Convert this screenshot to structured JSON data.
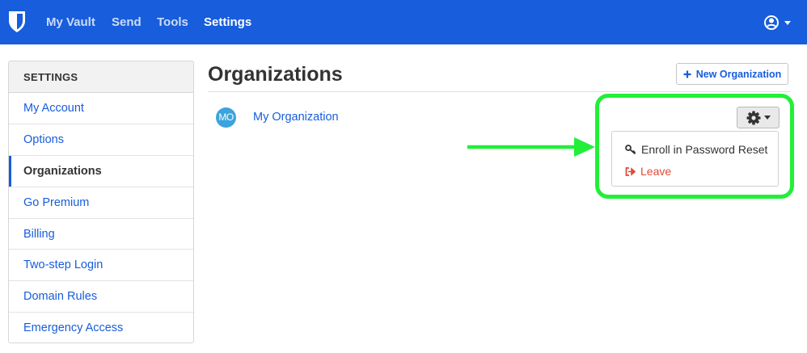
{
  "nav": {
    "items": [
      {
        "label": "My Vault",
        "active": false
      },
      {
        "label": "Send",
        "active": false
      },
      {
        "label": "Tools",
        "active": false
      },
      {
        "label": "Settings",
        "active": true
      }
    ]
  },
  "sidebar": {
    "header": "SETTINGS",
    "items": [
      {
        "label": "My Account",
        "active": false
      },
      {
        "label": "Options",
        "active": false
      },
      {
        "label": "Organizations",
        "active": true
      },
      {
        "label": "Go Premium",
        "active": false
      },
      {
        "label": "Billing",
        "active": false
      },
      {
        "label": "Two-step Login",
        "active": false
      },
      {
        "label": "Domain Rules",
        "active": false
      },
      {
        "label": "Emergency Access",
        "active": false
      }
    ]
  },
  "main": {
    "title": "Organizations",
    "new_button_label": "New Organization",
    "organization": {
      "initials": "MO",
      "name": "My Organization"
    },
    "dropdown": {
      "enroll_label": "Enroll in Password Reset",
      "leave_label": "Leave"
    }
  },
  "colors": {
    "brand": "#175ddc",
    "danger": "#dd4b39",
    "highlight": "#21ef38",
    "avatar": "#3ca3dc"
  },
  "icons": {
    "logo": "bitwarden-shield-icon",
    "profile": "user-circle-icon",
    "plus": "plus-icon",
    "gear": "gear-icon",
    "key": "key-icon",
    "leave": "sign-out-icon"
  }
}
